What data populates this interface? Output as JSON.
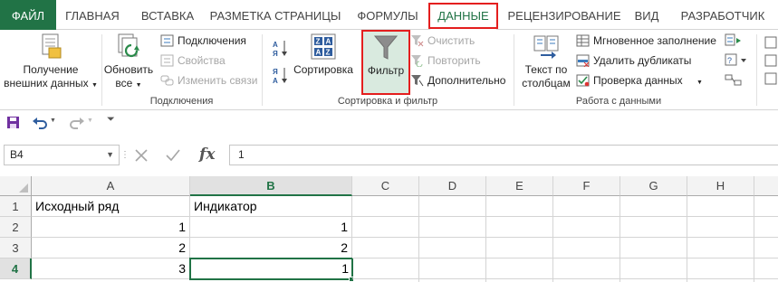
{
  "tabs": {
    "file": "ФАЙЛ",
    "home": "ГЛАВНАЯ",
    "insert": "ВСТАВКА",
    "page_layout": "РАЗМЕТКА СТРАНИЦЫ",
    "formulas": "ФОРМУЛЫ",
    "data": "ДАННЫЕ",
    "review": "РЕЦЕНЗИРОВАНИЕ",
    "view": "ВИД",
    "developer": "РАЗРАБОТЧИК"
  },
  "ribbon": {
    "get_external_data": {
      "line1": "Получение",
      "line2": "внешних данных"
    },
    "refresh_all": {
      "line1": "Обновить",
      "line2": "все"
    },
    "connections": "Подключения",
    "properties": "Свойства",
    "edit_links": "Изменить связи",
    "group_connections": "Подключения",
    "sort": "Сортировка",
    "filter": "Фильтр",
    "clear": "Очистить",
    "reapply": "Повторить",
    "advanced": "Дополнительно",
    "group_sort_filter": "Сортировка и фильтр",
    "text_to_columns": {
      "line1": "Текст по",
      "line2": "столбцам"
    },
    "flash_fill": "Мгновенное заполнение",
    "remove_duplicates": "Удалить дубликаты",
    "data_validation": "Проверка данных",
    "group_data_tools": "Работа с данными"
  },
  "formula_bar": {
    "name_box": "B4",
    "formula": "1",
    "fx": "fx"
  },
  "sheet": {
    "columns": [
      "A",
      "B",
      "C",
      "D",
      "E",
      "F",
      "G",
      "H"
    ],
    "rows": [
      "1",
      "2",
      "3",
      "4"
    ],
    "cells": {
      "A1": "Исходный ряд",
      "B1": "Индикатор",
      "A2": "1",
      "B2": "1",
      "A3": "2",
      "B3": "2",
      "A4": "3",
      "B4": "1"
    },
    "active_cell": "B4"
  },
  "colors": {
    "accent": "#217346",
    "highlight": "#e41e1e",
    "filter_bg": "#d9eadf"
  }
}
